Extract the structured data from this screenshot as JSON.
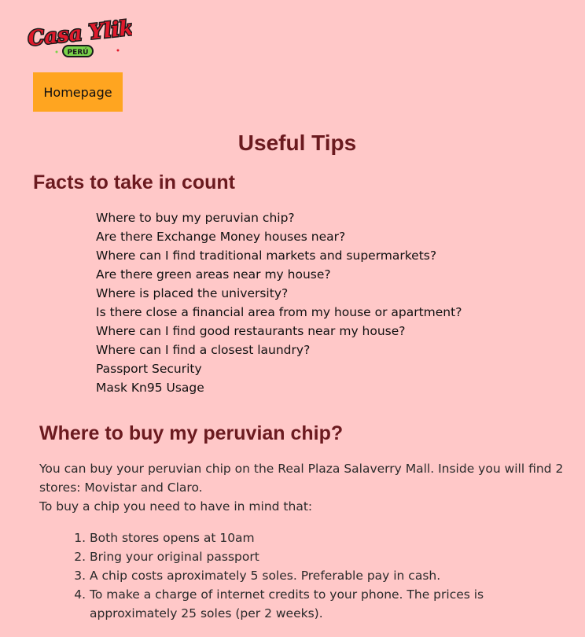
{
  "logo": {
    "text": "Casa Ylika",
    "subtext": "PERÚ"
  },
  "nav": {
    "home_label": "Homepage"
  },
  "page": {
    "title": "Useful Tips"
  },
  "facts": {
    "title": "Facts to take in count",
    "items": [
      "Where to buy my peruvian chip?",
      "Are there Exchange Money houses near?",
      "Where can I find traditional markets and supermarkets?",
      "Are there green areas near my house?",
      "Where is placed the university?",
      "Is there close a financial area from my house or apartment?",
      "Where can I find good restaurants near my house?",
      "Where can I find a closest laundry?",
      "Passport Security",
      "Mask Kn95 Usage"
    ]
  },
  "chip_section": {
    "title": "Where to buy my peruvian chip?",
    "paragraph_lines": [
      "You can buy your peruvian chip on the Real Plaza Salaverry Mall. Inside you will find 2 stores: Movistar and Claro.",
      "To buy a chip you need to have in mind that:"
    ],
    "steps": [
      "Both stores opens at 10am",
      "Bring your original passport",
      "A chip costs aproximately 5 soles. Preferable pay in cash.",
      "To make a charge of internet credits to your phone. The prices is approximately 25 soles (per 2 weeks)."
    ]
  },
  "colors": {
    "background": "#ffc8c8",
    "heading": "#6b1a1f",
    "button": "#ffa520",
    "logo_red": "#e0192b",
    "logo_green": "#7ad34a"
  }
}
